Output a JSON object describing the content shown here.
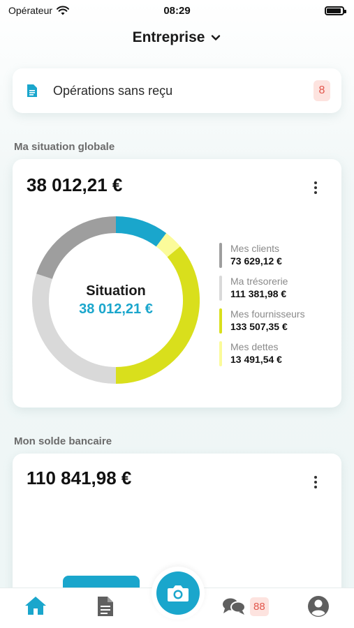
{
  "status_bar": {
    "carrier": "Opérateur",
    "time": "08:29",
    "battery_level": 0.9
  },
  "header": {
    "title": "Entreprise"
  },
  "operations": {
    "label": "Opérations sans reçu",
    "count": "8"
  },
  "situation": {
    "section_title": "Ma situation globale",
    "amount": "38 012,21 €",
    "center_title": "Situation",
    "center_amount": "38 012,21 €",
    "legend": [
      {
        "label": "Mes clients",
        "value": "73 629,12 €",
        "color": "#9e9e9e"
      },
      {
        "label": "Ma trésorerie",
        "value": "111 381,98 €",
        "color": "#d9d9d9"
      },
      {
        "label": "Mes fournisseurs",
        "value": "133 507,35 €",
        "color": "#d9df1c"
      },
      {
        "label": "Mes dettes",
        "value": "13 491,54 €",
        "color": "#fbfb9a"
      }
    ],
    "accent_color": "#1aa6cc"
  },
  "chart_data": {
    "type": "pie",
    "categories": [
      "Situation",
      "Mes dettes",
      "Mes fournisseurs",
      "Ma trésorerie",
      "Mes clients"
    ],
    "values": [
      38012.21,
      13491.54,
      133507.35,
      111381.98,
      73629.12
    ],
    "colors": [
      "#1aa6cc",
      "#fbfb9a",
      "#d9df1c",
      "#d9d9d9",
      "#9e9e9e"
    ],
    "donut": true
  },
  "bank": {
    "section_title": "Mon solde bancaire",
    "amount": "110 841,98 €"
  },
  "tabbar": {
    "items": [
      "home-icon",
      "document-icon",
      "camera-icon",
      "chat-icon",
      "profile-icon"
    ],
    "chat_badge": "88",
    "active_color": "#1aa6cc"
  }
}
